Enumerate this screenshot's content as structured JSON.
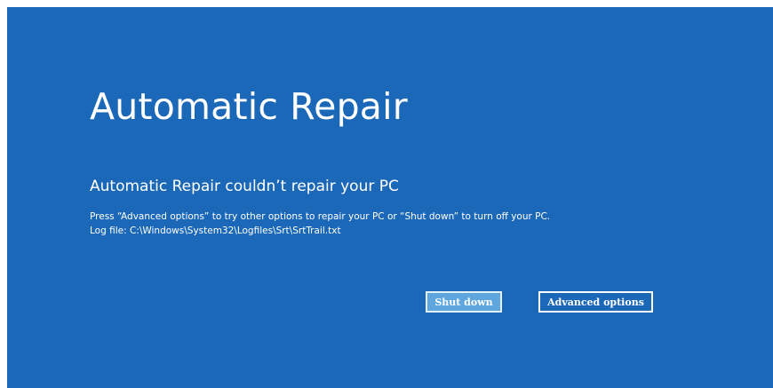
{
  "screen": {
    "title": "Automatic Repair",
    "subtitle": "Automatic Repair couldn’t repair your PC",
    "message_line1": "Press “Advanced options” to try other options to repair your PC or “Shut down” to turn off your PC.",
    "message_line2": "Log file: C:\\Windows\\System32\\Logfiles\\Srt\\SrtTrail.txt"
  },
  "buttons": {
    "shutdown_label": "Shut down",
    "advanced_label": "Advanced options"
  },
  "colors": {
    "background": "#1c68b8",
    "primary_button": "#5fa6de",
    "text": "#ffffff"
  }
}
